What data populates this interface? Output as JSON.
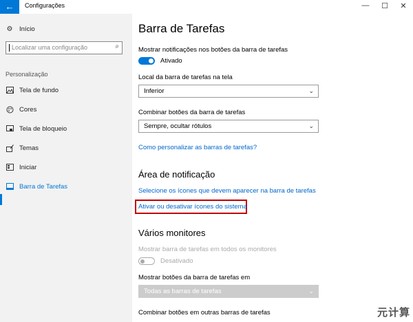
{
  "window": {
    "title": "Configurações",
    "back_icon": "arrow-left-icon",
    "controls": {
      "minimize": "—",
      "maximize": "☐",
      "close": "✕"
    }
  },
  "sidebar": {
    "home_label": "Início",
    "search_placeholder": "Localizar uma configuração",
    "section": "Personalização",
    "items": [
      {
        "label": "Tela de fundo",
        "icon": "picture-icon"
      },
      {
        "label": "Cores",
        "icon": "palette-icon"
      },
      {
        "label": "Tela de bloqueio",
        "icon": "lock-screen-icon"
      },
      {
        "label": "Temas",
        "icon": "brush-icon"
      },
      {
        "label": "Iniciar",
        "icon": "start-icon"
      },
      {
        "label": "Barra de Tarefas",
        "icon": "taskbar-icon",
        "active": true
      }
    ]
  },
  "main": {
    "title": "Barra de Tarefas",
    "notify_label": "Mostrar notificações nos botões da barra de tarefas",
    "notify_state": "Ativado",
    "location_label": "Local da barra de tarefas na tela",
    "location_value": "Inferior",
    "combine_label": "Combinar botões da barra de tarefas",
    "combine_value": "Sempre, ocultar rótulos",
    "customize_link": "Como personalizar as barras de tarefas?",
    "notif_area_heading": "Área de notificação",
    "select_icons_link": "Selecione os ícones que devem aparecer na barra de tarefas",
    "system_icons_link": "Ativar ou desativar ícones do sistema",
    "multi_heading": "Vários monitores",
    "multi_show_label": "Mostrar barra de tarefas em todos os monitores",
    "multi_show_state": "Desativado",
    "multi_buttons_label": "Mostrar botões da barra de tarefas em",
    "multi_buttons_value": "Todas as barras de tarefas",
    "multi_combine_label": "Combinar botões em outras barras de tarefas"
  },
  "watermark": "元计算",
  "colors": {
    "accent": "#0078d7",
    "highlight_box": "#c00000",
    "link": "#0066cc"
  }
}
